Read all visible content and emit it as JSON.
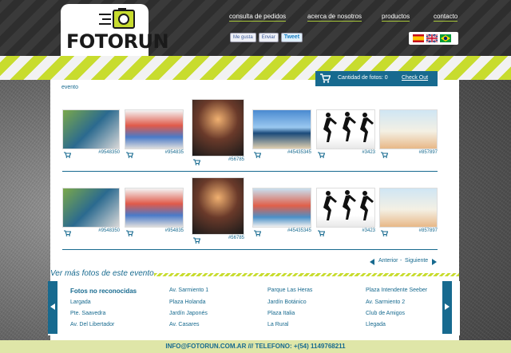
{
  "brand": {
    "logo_part1": "FOTO",
    "logo_part2": "RUN"
  },
  "nav": [
    {
      "label": "consulta de pedidos"
    },
    {
      "label": "acerca de nosotros"
    },
    {
      "label": "productos"
    },
    {
      "label": "contacto"
    }
  ],
  "social": {
    "like": "Me gusta",
    "send": "Enviar",
    "tweet": "Tweet"
  },
  "languages": [
    "spanish-flag-icon",
    "uk-flag-icon",
    "brazil-flag-icon"
  ],
  "cart": {
    "label": "Cantidad de fotos: 0",
    "checkout": "Check Out"
  },
  "breadcrumb": "evento",
  "gallery_rows": [
    [
      {
        "id": "#9548350",
        "icon": "runner-shoes-photo"
      },
      {
        "id": "#954835",
        "icon": "race-crowd-photo"
      },
      {
        "id": "#56785",
        "icon": "track-sprinter-photo"
      },
      {
        "id": "#45435345",
        "icon": "beach-runner-photo"
      },
      {
        "id": "#3423",
        "icon": "silhouette-runners-photo"
      },
      {
        "id": "#857897",
        "icon": "desert-runner-photo"
      }
    ],
    [
      {
        "id": "#9548350",
        "icon": "runner-shoes-photo"
      },
      {
        "id": "#954835",
        "icon": "race-crowd-photo"
      },
      {
        "id": "#56785",
        "icon": "track-sprinter-photo"
      },
      {
        "id": "#45435345",
        "icon": "race-finish-photo"
      },
      {
        "id": "#3423",
        "icon": "silhouette-runners-photo"
      },
      {
        "id": "#857897",
        "icon": "desert-runner-photo"
      }
    ]
  ],
  "pager": {
    "prev": "Anterior",
    "sep": "-",
    "next": "Siguiente"
  },
  "more_title": "Ver más fotos de este evento",
  "links": [
    [
      "Fotos no reconocidas",
      "Largada",
      "Pte. Saavedra",
      "Av. Del Libertador"
    ],
    [
      "Av. Sarmiento 1",
      "Plaza Holanda",
      "Jardín Japonés",
      "Av. Casares"
    ],
    [
      "Parque Las Heras",
      "Jardín Botánico",
      "Plaza Italia",
      "La Rural"
    ],
    [
      "Plaza Intendente Seeber",
      "Av. Sarmiento 2",
      "Club de Amigos",
      "Llegada"
    ]
  ],
  "footer": "INFO@FOTORUN.COM.AR /// TELEFONO: +(54) 1149768211",
  "colors": {
    "accent": "#176a8f",
    "stripe": "#c8dc2e"
  }
}
